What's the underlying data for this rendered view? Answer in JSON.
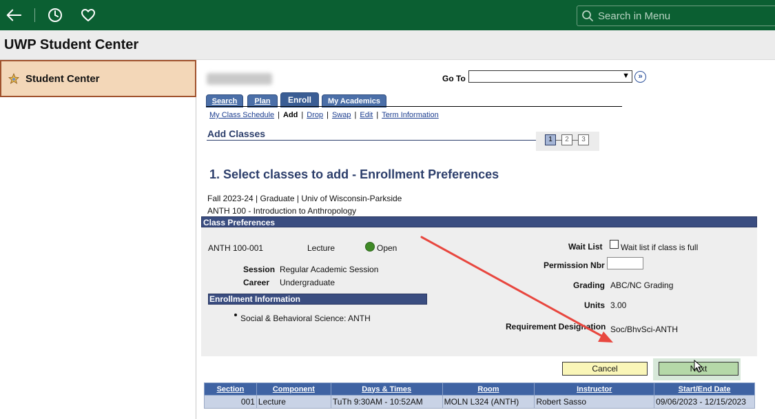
{
  "topbar": {
    "back_icon": "back-arrow-icon",
    "history_icon": "clock-icon",
    "favorites_icon": "heart-icon",
    "search_placeholder": "Search in Menu",
    "bg_color": "#0b5f32"
  },
  "app_title": "UWP Student Center",
  "sidebar": {
    "items": [
      {
        "label": "Student Center",
        "icon": "student-center-icon",
        "selected": true
      }
    ]
  },
  "goto": {
    "label": "Go To",
    "value": ""
  },
  "tabs": [
    {
      "label": "Search",
      "active": false
    },
    {
      "label": "Plan",
      "active": false
    },
    {
      "label": "Enroll",
      "active": true
    },
    {
      "label": "My Academics",
      "active": false
    }
  ],
  "subnav": {
    "items": [
      {
        "label": "My Class Schedule",
        "link": true
      },
      {
        "label": "Add",
        "link": false
      },
      {
        "label": "Drop",
        "link": true
      },
      {
        "label": "Swap",
        "link": true
      },
      {
        "label": "Edit",
        "link": true
      },
      {
        "label": "Term Information",
        "link": true
      }
    ]
  },
  "page_title": "Add Classes",
  "steps": {
    "labels": [
      "1",
      "2",
      "3"
    ],
    "current": 1
  },
  "heading": "1.  Select classes to add - Enrollment Preferences",
  "term_line": "Fall 2023-24 | Graduate | Univ of Wisconsin-Parkside",
  "course_line": "ANTH  100 - Introduction to Anthropology",
  "class_preferences": {
    "header": "Class Preferences",
    "class_id": "ANTH  100-001",
    "component": "Lecture",
    "status": "Open",
    "status_color": "#3f8a26",
    "session_label": "Session",
    "session_value": "Regular Academic Session",
    "career_label": "Career",
    "career_value": "Undergraduate",
    "enrollment_info_header": "Enrollment Information",
    "enrollment_info_items": [
      "Social & Behavioral Science: ANTH"
    ],
    "wait_list_label": "Wait List",
    "wait_list_checkbox_label": "Wait list if class is full",
    "wait_list_checked": false,
    "permission_label": "Permission Nbr",
    "permission_value": "",
    "grading_label": "Grading",
    "grading_value": "ABC/NC Grading",
    "units_label": "Units",
    "units_value": "3.00",
    "requirement_label": "Requirement Designation",
    "requirement_value": "Soc/BhvSci-ANTH"
  },
  "buttons": {
    "cancel": "Cancel",
    "next": "Next"
  },
  "sections_table": {
    "columns": [
      "Section",
      "Component",
      "Days & Times",
      "Room",
      "Instructor",
      "Start/End Date"
    ],
    "rows": [
      [
        "001",
        "Lecture",
        "TuTh 9:30AM - 10:52AM",
        "MOLN L324 (ANTH)",
        "Robert Sasso",
        "09/06/2023 - 12/15/2023"
      ]
    ]
  },
  "annotation_color": "#e8473f"
}
